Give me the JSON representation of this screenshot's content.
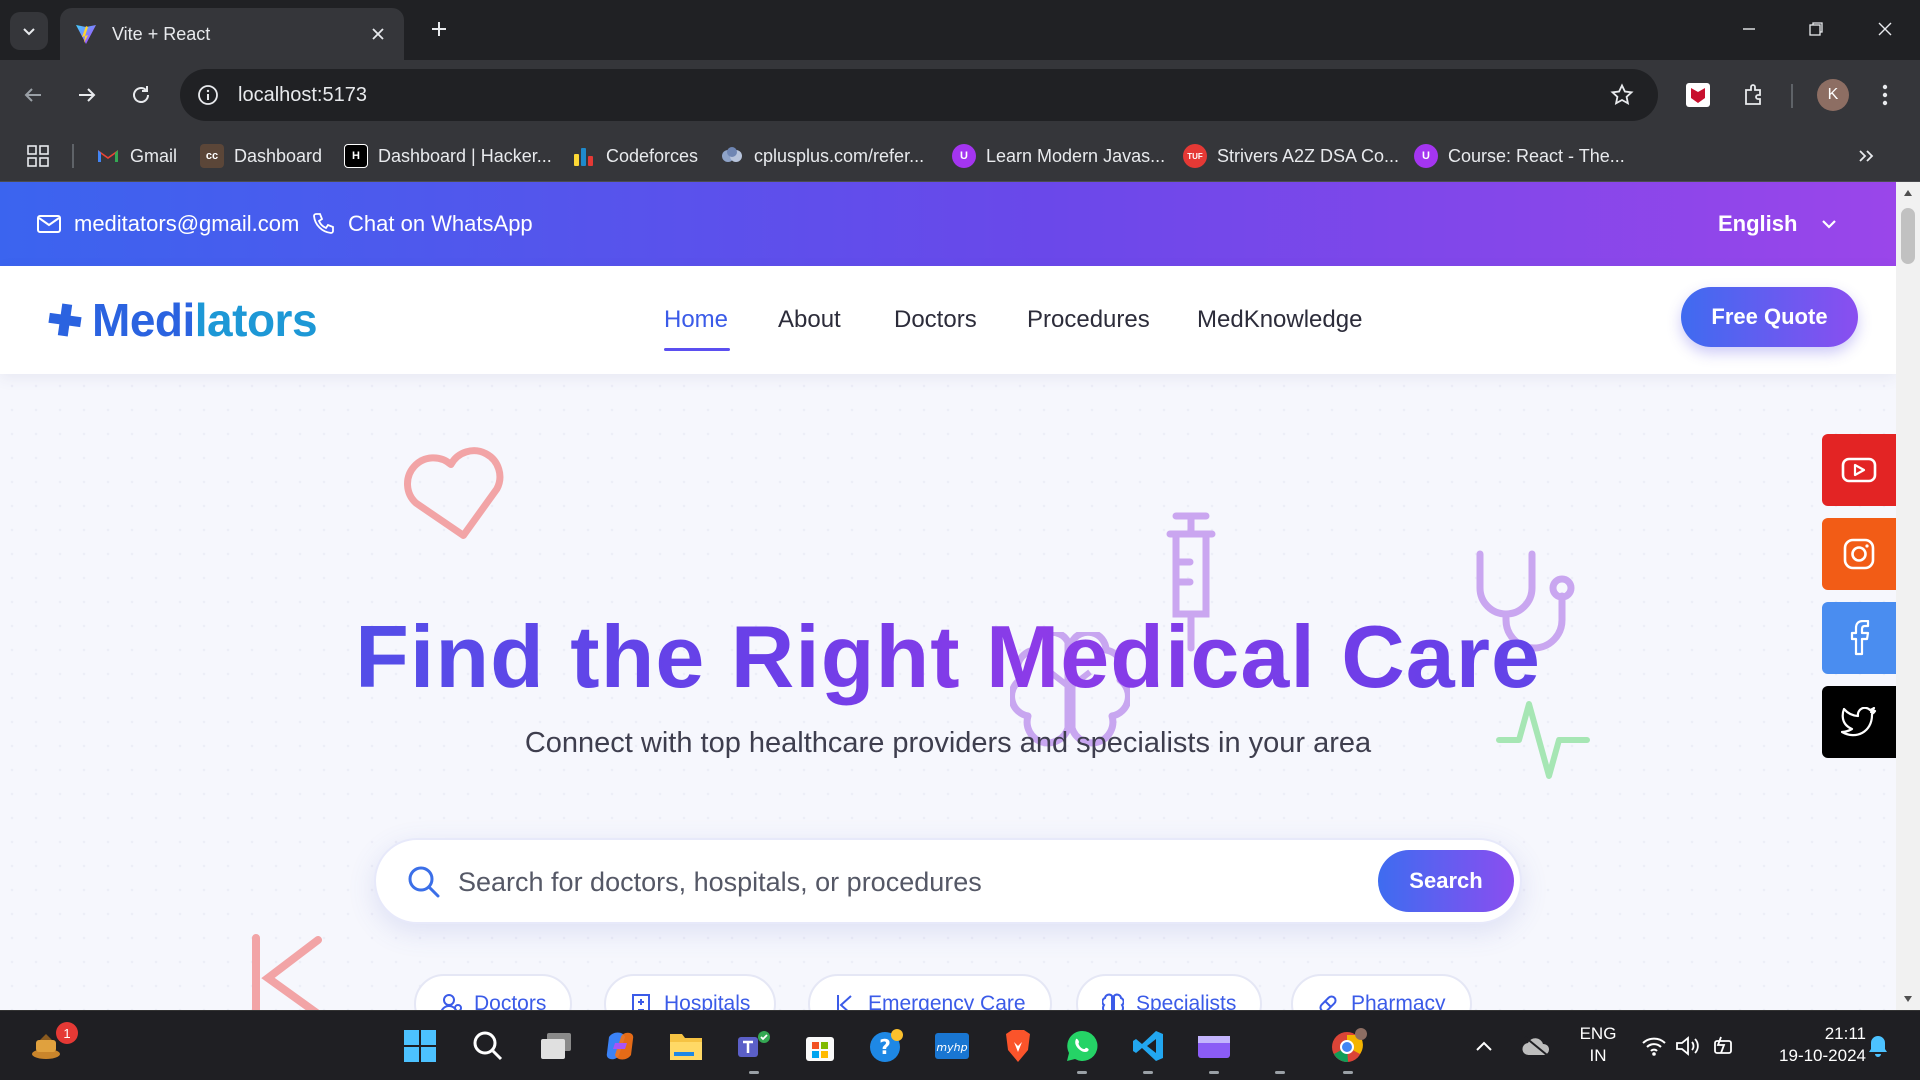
{
  "browser": {
    "tab_title": "Vite + React",
    "url": "localhost:5173",
    "profile_initial": "K",
    "bookmarks": [
      {
        "label": "Gmail",
        "icon": "gmail-icon",
        "color": "#ea4335"
      },
      {
        "label": "Dashboard",
        "icon": "codechef-icon",
        "color": "#5b4638"
      },
      {
        "label": "Dashboard | Hacker...",
        "icon": "hackerrank-icon",
        "color": "#000000"
      },
      {
        "label": "Codeforces",
        "icon": "codeforces-icon",
        "color": "#1f8acb"
      },
      {
        "label": "cplusplus.com/refer...",
        "icon": "cplusplus-icon",
        "color": "#8ea3c8"
      },
      {
        "label": "Learn Modern Javas...",
        "icon": "udemy-icon",
        "color": "#a435f0"
      },
      {
        "label": "Strivers A2Z DSA Co...",
        "icon": "tuf-icon",
        "color": "#e53935"
      },
      {
        "label": "Course: React - The...",
        "icon": "udemy-icon",
        "color": "#a435f0"
      }
    ]
  },
  "topbar": {
    "email": "meditators@gmail.com",
    "whatsapp": "Chat on WhatsApp",
    "language": "English"
  },
  "navbar": {
    "brand_prefix": "Medi",
    "brand_suffix": "lators",
    "links": [
      "Home",
      "About",
      "Doctors",
      "Procedures",
      "MedKnowledge"
    ],
    "active": "Home",
    "cta": "Free Quote"
  },
  "hero": {
    "title": "Find the Right Medical Care",
    "subtitle": "Connect with top healthcare providers and specialists in your area",
    "search_placeholder": "Search for doctors, hospitals, or procedures",
    "search_button": "Search",
    "chips": [
      "Doctors",
      "Hospitals",
      "Emergency Care",
      "Specialists",
      "Pharmacy"
    ]
  },
  "social": [
    {
      "name": "youtube-icon",
      "color": "#e32424"
    },
    {
      "name": "instagram-icon",
      "color": "#f25c16"
    },
    {
      "name": "facebook-icon",
      "color": "#4a8df0"
    },
    {
      "name": "twitter-icon",
      "color": "#000000"
    }
  ],
  "taskbar": {
    "notification_count": "1",
    "lang_primary": "ENG",
    "lang_secondary": "IN",
    "time": "21:11",
    "date": "19-10-2024"
  },
  "colors": {
    "brand_blue": "#2b63e0",
    "accent_purple": "#6a3fe8",
    "topbar_start": "#3b64ef",
    "topbar_end": "#9a46ea"
  }
}
